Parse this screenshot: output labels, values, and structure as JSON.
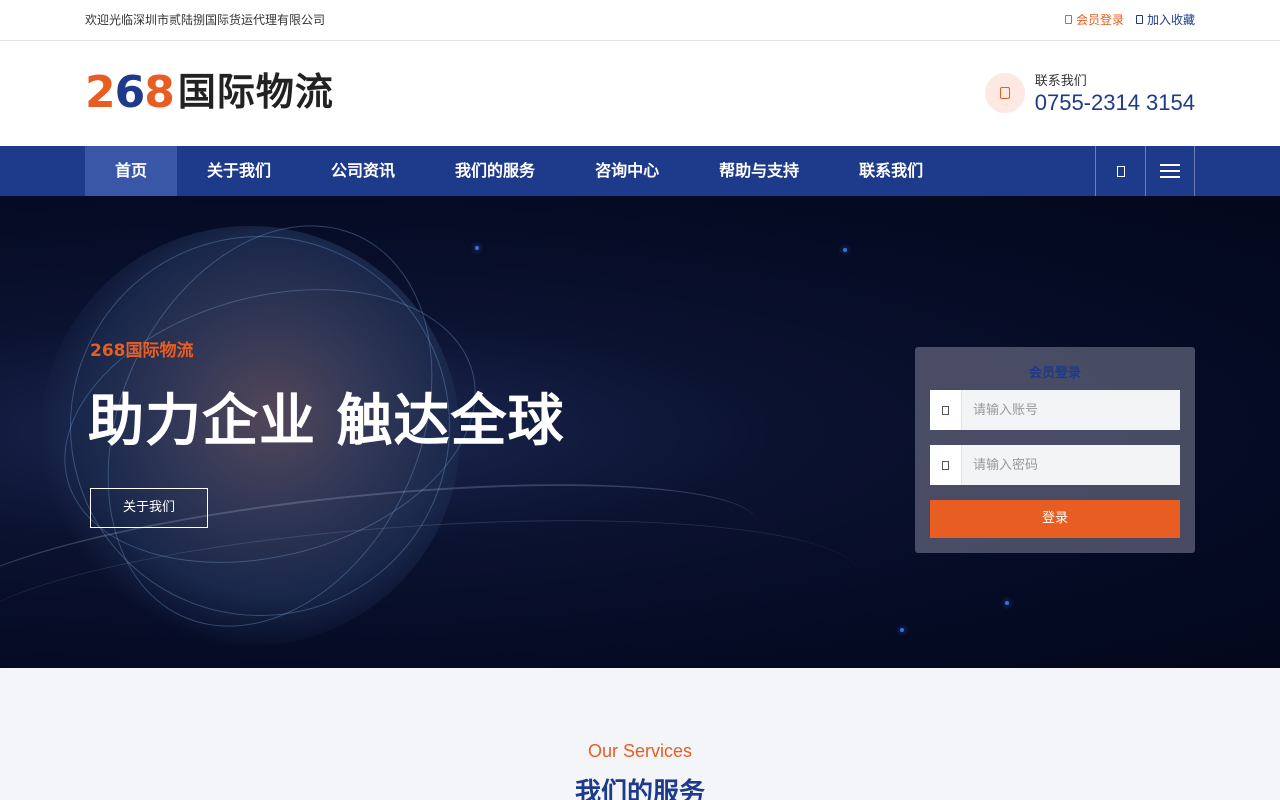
{
  "topbar": {
    "welcome": "欢迎光临深圳市贰陆捌国际货运代理有限公司",
    "member_login": "会员登录",
    "add_favorite": "加入收藏"
  },
  "header": {
    "logo_number_digits": [
      "2",
      "6",
      "8"
    ],
    "logo_text": "国际物流",
    "contact_label": "联系我们",
    "contact_phone": "0755-2314 3154"
  },
  "nav": {
    "items": [
      {
        "label": "首页",
        "active": true
      },
      {
        "label": "关于我们"
      },
      {
        "label": "公司资讯"
      },
      {
        "label": "我们的服务"
      },
      {
        "label": "咨询中心"
      },
      {
        "label": "帮助与支持"
      },
      {
        "label": "联系我们"
      }
    ]
  },
  "hero": {
    "subtitle": "268国际物流",
    "title": "助力企业 触达全球",
    "button": "关于我们"
  },
  "login": {
    "title": "会员登录",
    "username_placeholder": "请输入账号",
    "password_placeholder": "请输入密码",
    "submit": "登录"
  },
  "services": {
    "english": "Our Services",
    "chinese": "我们的服务"
  },
  "colors": {
    "brand_blue": "#1e3a8a",
    "accent_orange": "#e85d22"
  },
  "icons": [
    "member-icon",
    "favorite-icon",
    "phone-icon",
    "search-icon",
    "menu-icon",
    "user-icon",
    "lock-icon"
  ]
}
